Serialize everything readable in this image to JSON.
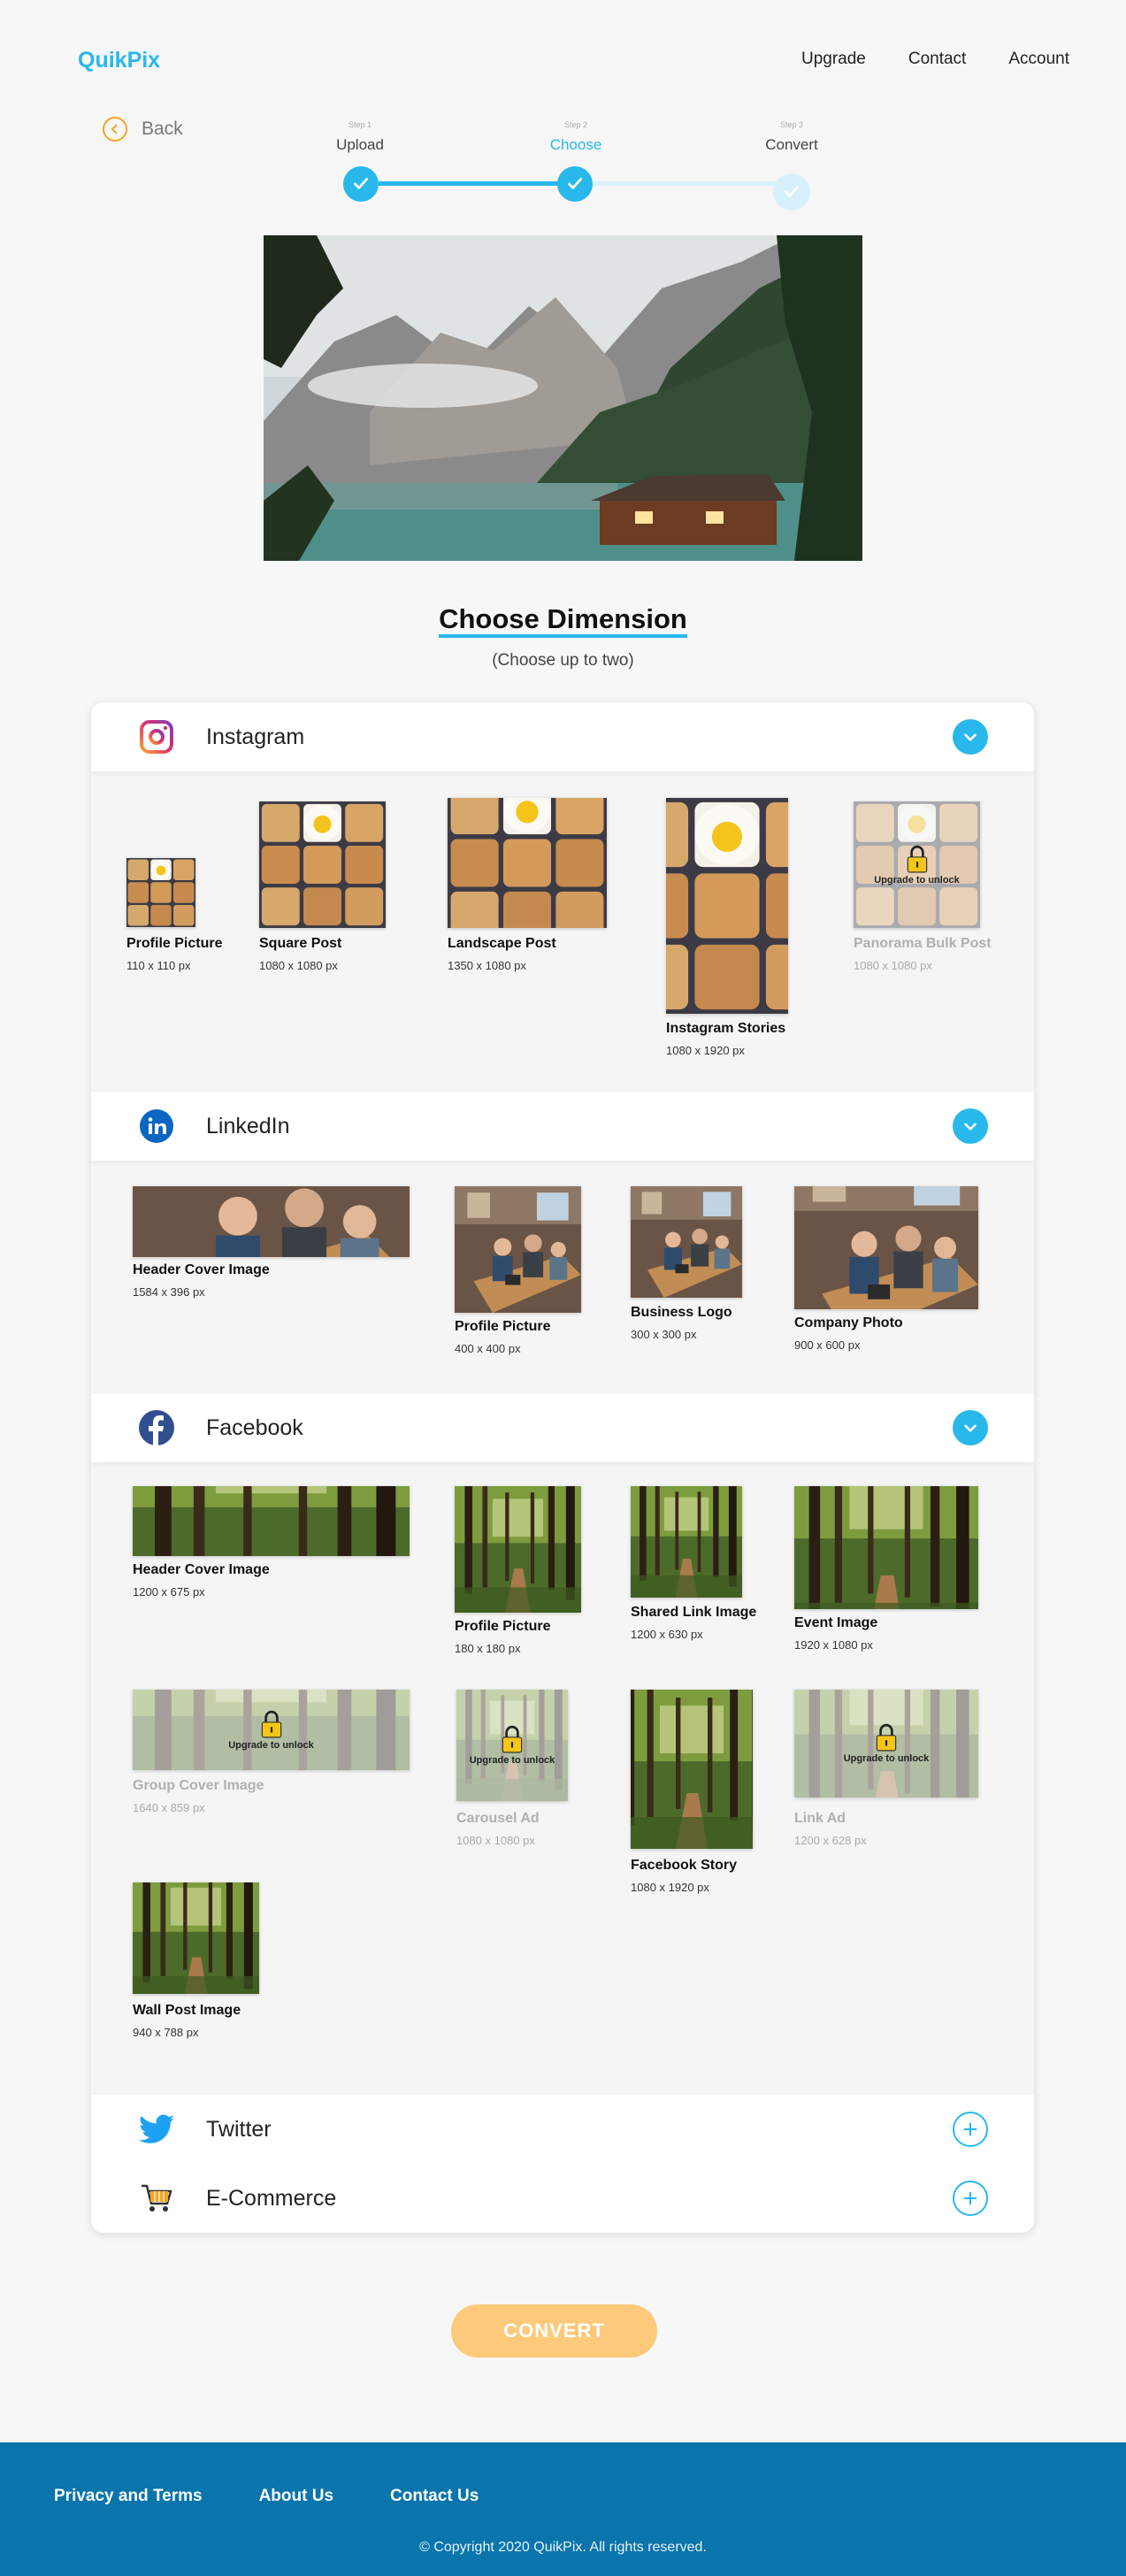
{
  "header": {
    "logo": "QuikPix",
    "nav": [
      "Upgrade",
      "Contact",
      "Account"
    ]
  },
  "back_label": "Back",
  "stepper": [
    {
      "small": "Step 1",
      "label": "Upload",
      "state": "done"
    },
    {
      "small": "Step 2",
      "label": "Choose",
      "state": "active"
    },
    {
      "small": "Step 3",
      "label": "Convert",
      "state": "pending"
    }
  ],
  "title": "Choose Dimension",
  "subtitle": "(Choose up to two)",
  "upgrade_text": "Upgrade to unlock",
  "sections": {
    "instagram": {
      "title": "Instagram",
      "items": [
        {
          "name": "Profile Picture",
          "dim": "110 x 110 px"
        },
        {
          "name": "Square Post",
          "dim": "1080 x 1080 px"
        },
        {
          "name": "Landscape Post",
          "dim": "1350 x 1080 px"
        },
        {
          "name": "Instagram Stories",
          "dim": "1080 x 1920 px"
        },
        {
          "name": "Panorama Bulk Post",
          "dim": "1080 x 1080 px",
          "locked": true
        }
      ]
    },
    "linkedin": {
      "title": "LinkedIn",
      "items": [
        {
          "name": "Header Cover Image",
          "dim": "1584 x 396 px"
        },
        {
          "name": "Profile Picture",
          "dim": "400 x 400 px"
        },
        {
          "name": "Business Logo",
          "dim": "300 x 300 px"
        },
        {
          "name": "Company Photo",
          "dim": "900 x 600 px"
        }
      ]
    },
    "facebook": {
      "title": "Facebook",
      "items": [
        {
          "name": "Header Cover Image",
          "dim": "1200 x 675 px"
        },
        {
          "name": "Profile Picture",
          "dim": "180 x 180 px"
        },
        {
          "name": "Shared Link Image",
          "dim": "1200 x 630 px"
        },
        {
          "name": "Event Image",
          "dim": "1920 x 1080 px"
        },
        {
          "name": "Group Cover Image",
          "dim": "1640 x 859 px",
          "locked": true
        },
        {
          "name": "Carousel Ad",
          "dim": "1080 x 1080 px",
          "locked": true
        },
        {
          "name": "Facebook Story",
          "dim": "1080 x 1920 px"
        },
        {
          "name": "Link Ad",
          "dim": "1200 x 628 px",
          "locked": true
        },
        {
          "name": "Wall Post Image",
          "dim": "940 x 788 px"
        }
      ]
    },
    "twitter": {
      "title": "Twitter"
    },
    "ecommerce": {
      "title": "E-Commerce"
    }
  },
  "convert_label": "CONVERT",
  "footer": {
    "links": [
      "Privacy and Terms",
      "About Us",
      "Contact Us"
    ],
    "copyright": "© Copyright 2020 QuikPix. All rights reserved."
  },
  "colors": {
    "accent": "#28b8ec",
    "convert": "#fdc97a",
    "footer": "#0a74ac",
    "back_icon": "#f5a623"
  }
}
